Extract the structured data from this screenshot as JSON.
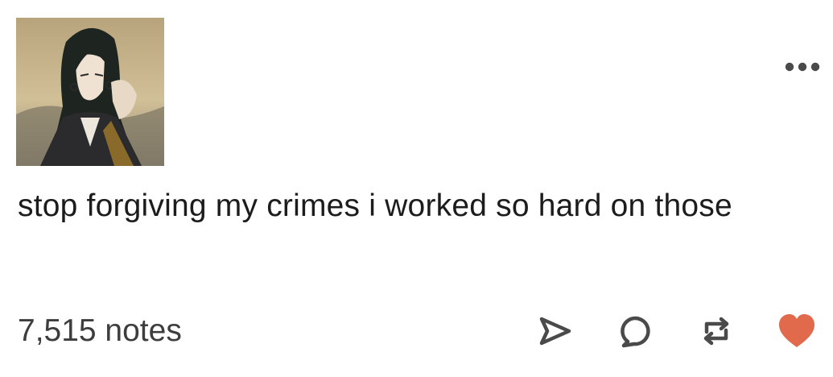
{
  "post": {
    "avatar": {
      "alt": "user avatar",
      "colors": {
        "sky": "#c9b48a",
        "hair": "#1f2622",
        "robe": "#2b2b2e",
        "sash": "#8a6a2a",
        "skin": "#efe2d2"
      }
    },
    "more_icon": "more-horizontal-icon",
    "text": "stop forgiving my crimes i worked so hard on those",
    "notes": "7,515 notes",
    "actions": [
      {
        "name": "share",
        "icon": "share-arrow-icon"
      },
      {
        "name": "reply",
        "icon": "speech-bubble-icon"
      },
      {
        "name": "reblog",
        "icon": "reblog-icon"
      },
      {
        "name": "like",
        "icon": "heart-icon",
        "color": "#e1694c",
        "state": "liked"
      }
    ],
    "icon_color": "#4a4a4a"
  }
}
